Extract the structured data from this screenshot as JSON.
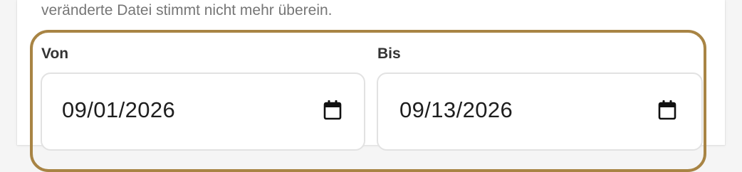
{
  "form": {
    "help_text": "veränderte Datei stimmt nicht mehr überein.",
    "from": {
      "label": "Von",
      "value": "09/01/2026",
      "icon": "calendar-icon"
    },
    "to": {
      "label": "Bis",
      "value": "09/13/2026",
      "icon": "calendar-icon"
    }
  },
  "colors": {
    "focus_border": "#a88444",
    "input_border": "#e2e2e2",
    "label_text": "#333333",
    "help_text": "#767676"
  }
}
